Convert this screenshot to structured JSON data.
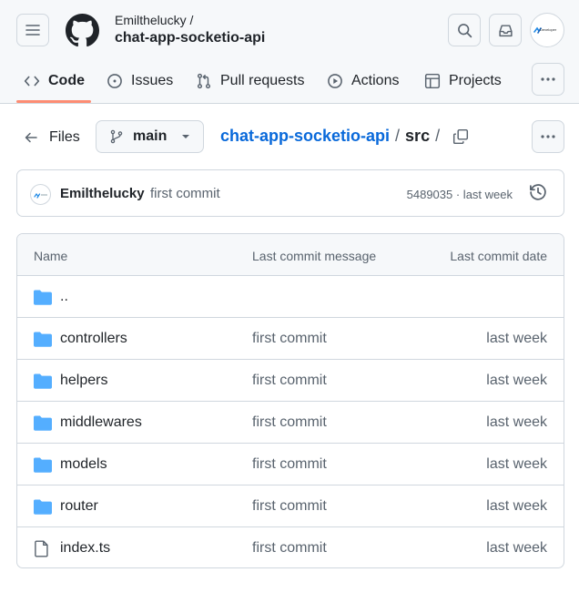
{
  "header": {
    "owner": "Emilthelucky /",
    "repo": "chat-app-socketio-api",
    "avatar_text": "Developer"
  },
  "tabs": [
    {
      "label": "Code",
      "icon": "code-icon",
      "active": true
    },
    {
      "label": "Issues",
      "icon": "issue-icon"
    },
    {
      "label": "Pull requests",
      "icon": "pull-request-icon"
    },
    {
      "label": "Actions",
      "icon": "play-icon"
    },
    {
      "label": "Projects",
      "icon": "table-icon"
    }
  ],
  "pathbar": {
    "files_label": "Files",
    "branch": "main",
    "repo_link": "chat-app-socketio-api",
    "sep1": "/",
    "current": "src",
    "sep2": "/"
  },
  "commit": {
    "author": "Emilthelucky",
    "message": "first commit",
    "meta": "5489035 · last week"
  },
  "table": {
    "headers": [
      "Name",
      "Last commit message",
      "Last commit date"
    ],
    "rows": [
      {
        "name": "..",
        "type": "folder",
        "message": "",
        "date": ""
      },
      {
        "name": "controllers",
        "type": "folder",
        "message": "first commit",
        "date": "last week"
      },
      {
        "name": "helpers",
        "type": "folder",
        "message": "first commit",
        "date": "last week"
      },
      {
        "name": "middlewares",
        "type": "folder",
        "message": "first commit",
        "date": "last week"
      },
      {
        "name": "models",
        "type": "folder",
        "message": "first commit",
        "date": "last week"
      },
      {
        "name": "router",
        "type": "folder",
        "message": "first commit",
        "date": "last week"
      },
      {
        "name": "index.ts",
        "type": "file",
        "message": "first commit",
        "date": "last week"
      }
    ]
  },
  "colors": {
    "accent": "#0969da",
    "folder": "#54aeff",
    "tab_underline": "#fd8c73"
  }
}
